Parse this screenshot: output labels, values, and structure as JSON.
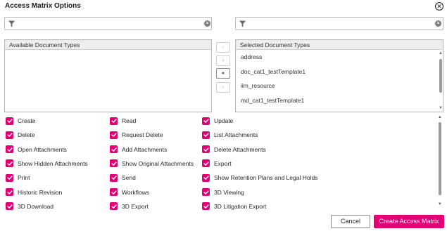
{
  "dialog": {
    "title": "Access Matrix Options",
    "close_icon": "close-circle-icon"
  },
  "filters": {
    "left": {
      "value": "",
      "icon": "filter-icon",
      "clear_icon": "clear-icon"
    },
    "right": {
      "value": "",
      "icon": "filter-icon",
      "clear_icon": "clear-icon"
    }
  },
  "available": {
    "header": "Available Document Types",
    "items": []
  },
  "selected": {
    "header": "Selected Document Types",
    "items": [
      "address",
      "doc_cat1_testTemplate1",
      "ilm_resource",
      "md_cat1_testTemplate1"
    ]
  },
  "move_buttons": [
    {
      "label": "›",
      "icon": "move-right-icon",
      "enabled": false
    },
    {
      "label": "»",
      "icon": "move-all-right-icon",
      "enabled": false
    },
    {
      "label": "«",
      "icon": "move-all-left-icon",
      "enabled": true
    },
    {
      "label": "‹",
      "icon": "move-left-icon",
      "enabled": false
    }
  ],
  "permissions": [
    [
      "Create",
      "Read",
      "Update"
    ],
    [
      "Delete",
      "Request Delete",
      "List Attachments"
    ],
    [
      "Open Attachments",
      "Add Attachments",
      "Delete Attachments"
    ],
    [
      "Show Hidden Attachments",
      "Show Original Attachments",
      "Export"
    ],
    [
      "Print",
      "Send",
      "Show Retention Plans and Legal Holds"
    ],
    [
      "Historic Revision",
      "Workflows",
      "3D Viewing"
    ],
    [
      "3D Download",
      "3D Export",
      "3D Litigation Export"
    ]
  ],
  "checked": true,
  "colors": {
    "accent": "#e20074"
  },
  "actions": {
    "cancel_label": "Cancel",
    "create_label": "Create Access Matrix"
  }
}
